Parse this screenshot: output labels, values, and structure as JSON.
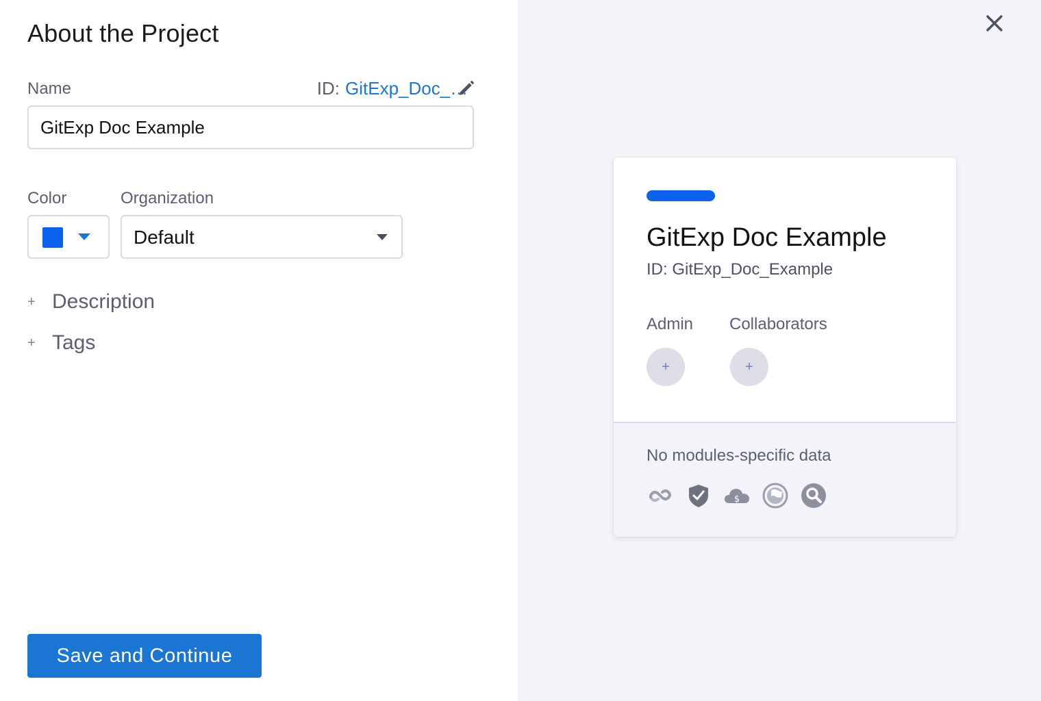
{
  "form": {
    "title": "About the Project",
    "name_label": "Name",
    "id_prefix": "ID:",
    "id_value": "GitExp_Doc_Example",
    "name_value": "GitExp Doc Example",
    "color_label": "Color",
    "color_value": "#0b63ec",
    "organization_label": "Organization",
    "organization_value": "Default",
    "description_toggle": "Description",
    "tags_toggle": "Tags",
    "save_button": "Save and Continue",
    "plus_symbol": "+"
  },
  "preview": {
    "name": "GitExp Doc Example",
    "id_line": "ID: GitExp_Doc_Example",
    "admin_label": "Admin",
    "collaborators_label": "Collaborators",
    "add_symbol": "+",
    "no_modules_text": "No modules-specific data",
    "module_icons": [
      "ci-infinity-icon",
      "shield-check-icon",
      "cloud-cost-icon",
      "flag-circle-icon",
      "search-circle-icon"
    ]
  },
  "colors": {
    "accent": "#1a76d2",
    "project_color": "#0b63ec",
    "right_panel_bg": "#f3f4f9"
  }
}
